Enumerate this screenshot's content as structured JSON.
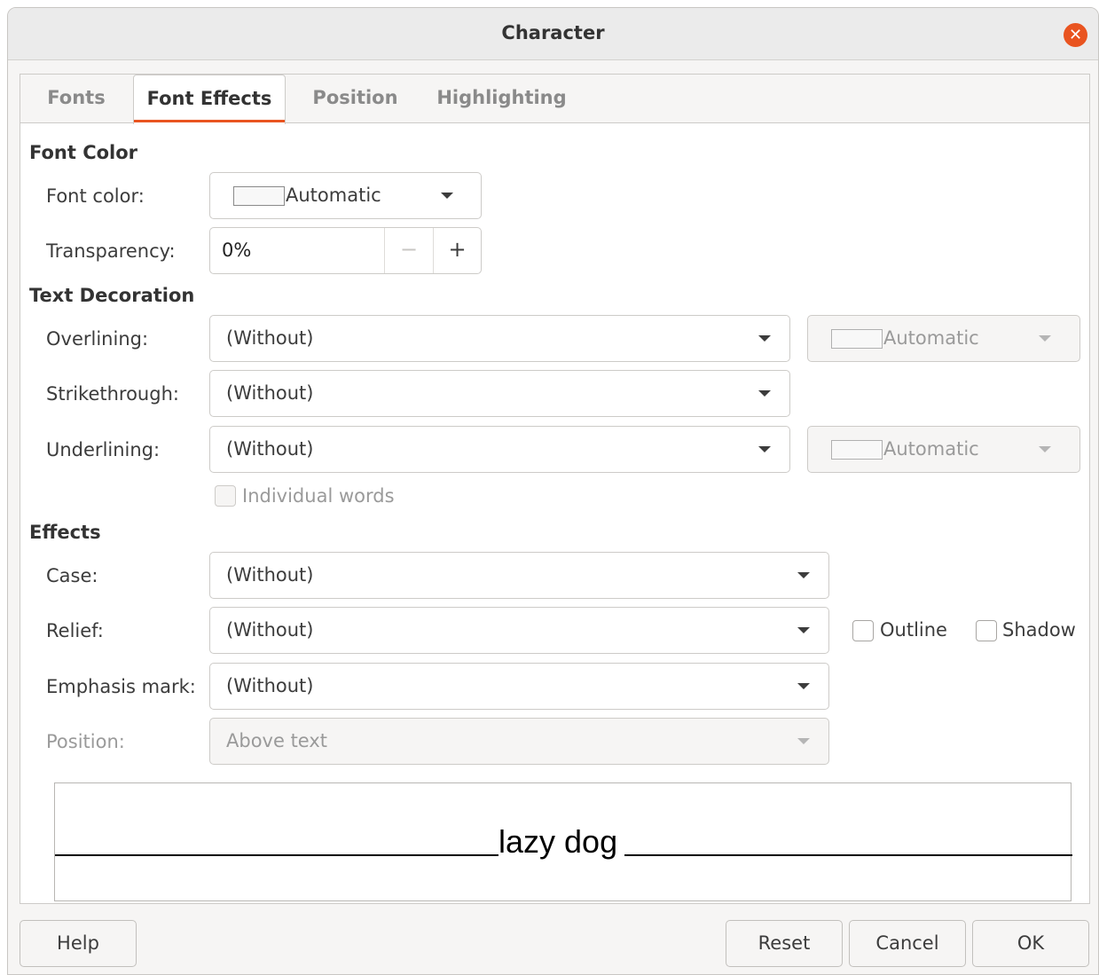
{
  "window": {
    "title": "Character",
    "close_icon": "close-icon"
  },
  "tabs": [
    {
      "label": "Fonts",
      "active": false
    },
    {
      "label": "Font Effects",
      "active": true
    },
    {
      "label": "Position",
      "active": false
    },
    {
      "label": "Highlighting",
      "active": false
    }
  ],
  "font_color_section": {
    "heading": "Font Color",
    "font_color_label": "Font color:",
    "font_color_value": "Automatic",
    "transparency_label": "Transparency:",
    "transparency_value": "0%",
    "minus": "−",
    "plus": "+"
  },
  "text_decoration": {
    "heading": "Text Decoration",
    "overlining_label": "Overlining:",
    "overlining_value": "(Without)",
    "overline_color": "Automatic",
    "strikethrough_label": "Strikethrough:",
    "strikethrough_value": "(Without)",
    "underlining_label": "Underlining:",
    "underlining_value": "(Without)",
    "underline_color": "Automatic",
    "individual_words_label": "Individual words",
    "individual_words_checked": false
  },
  "effects": {
    "heading": "Effects",
    "case_label": "Case:",
    "case_value": "(Without)",
    "relief_label": "Relief:",
    "relief_value": "(Without)",
    "outline_label": "Outline",
    "outline_checked": false,
    "shadow_label": "Shadow",
    "shadow_checked": false,
    "emphasis_label": "Emphasis mark:",
    "emphasis_value": "(Without)",
    "position_label": "Position:",
    "position_value": "Above text"
  },
  "preview": {
    "text": "lazy dog"
  },
  "buttons": {
    "help": "Help",
    "reset": "Reset",
    "cancel": "Cancel",
    "ok": "OK"
  },
  "colors": {
    "accent": "#e95420",
    "window_bg": "#f6f5f4"
  }
}
